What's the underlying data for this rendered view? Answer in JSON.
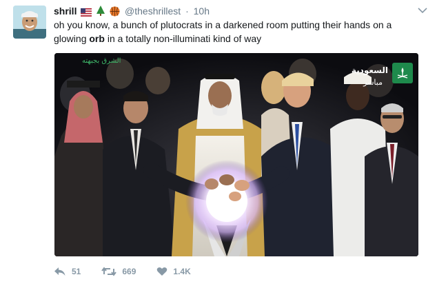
{
  "user": {
    "display_name": "shrill",
    "handle": "@theshrillest",
    "time": "10h",
    "emoji_icons": [
      "us-flag-icon",
      "christmas-tree-icon",
      "basketball-icon"
    ]
  },
  "tweet": {
    "text_before": "oh you know, a bunch of plutocrats in a darkened room putting their hands on a glowing ",
    "bold_word": "orb",
    "text_after": " in a totally non-illuminati kind of way"
  },
  "media": {
    "overlay_logo_left": "الشرق بجبهته",
    "broadcast_channel": "السعودية",
    "broadcast_live": "مباشر"
  },
  "actions": {
    "reply_count": "51",
    "retweet_count": "669",
    "like_count": "1.4K"
  },
  "colors": {
    "text": "#14171a",
    "muted": "#657786",
    "action_grey": "#8899a6",
    "channel_green": "#1e8a4c"
  }
}
